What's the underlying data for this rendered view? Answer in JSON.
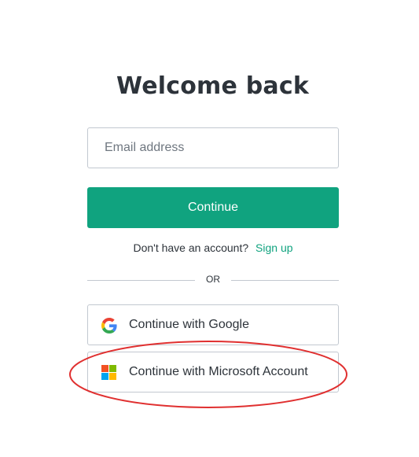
{
  "page": {
    "title": "Welcome back"
  },
  "form": {
    "email_placeholder": "Email address",
    "email_value": "",
    "continue_label": "Continue"
  },
  "signup": {
    "prompt": "Don't have an account?",
    "link_label": "Sign up"
  },
  "divider": {
    "label": "OR"
  },
  "social": {
    "google": {
      "label": "Continue with Google",
      "icon": "google-icon"
    },
    "microsoft": {
      "label": "Continue with Microsoft Account",
      "icon": "microsoft-icon"
    }
  },
  "colors": {
    "accent": "#10a37f",
    "text": "#2d333a",
    "border": "#c2c8d0",
    "annotation": "#e03030",
    "ms_red": "#f25022",
    "ms_green": "#7fba00",
    "ms_blue": "#00a4ef",
    "ms_yellow": "#ffb900"
  }
}
